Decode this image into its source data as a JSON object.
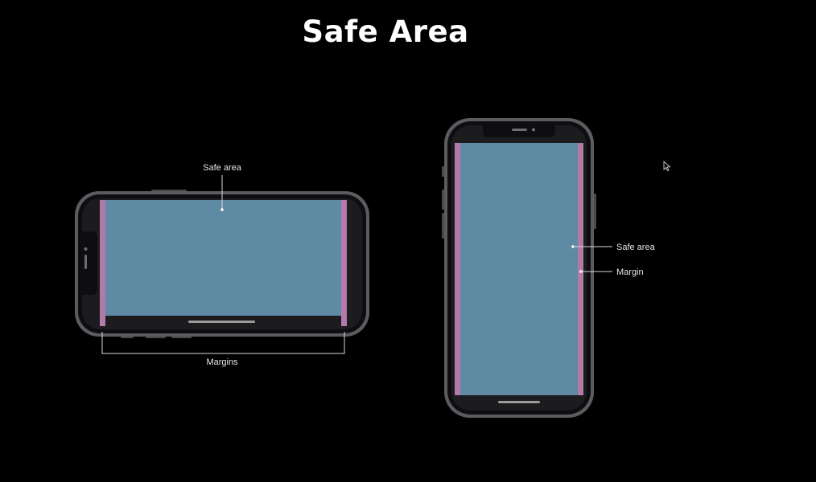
{
  "title": "Safe Area",
  "landscape": {
    "safe_area_label": "Safe area",
    "margins_label": "Margins"
  },
  "portrait": {
    "safe_area_label": "Safe area",
    "margin_label": "Margin"
  },
  "colors": {
    "background": "#000000",
    "phone_frame": "#5a5a5e",
    "screen": "#1c1c1e",
    "safe_area": "#5f8aa3",
    "margin": "#b27aa8",
    "callout_line": "#d9d9d9"
  }
}
